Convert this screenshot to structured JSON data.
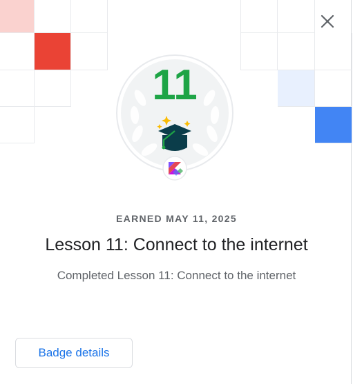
{
  "badge": {
    "number": "11",
    "icon": "graduation-cap-icon",
    "logo": "kotlin-logo-icon"
  },
  "earned_label": "EARNED MAY 11, 2025",
  "title": "Lesson 11: Connect to the internet",
  "subtitle": "Completed Lesson 11: Connect to the internet",
  "details_button": "Badge details",
  "close_icon": "close-icon",
  "colors": {
    "badge_green": "#1ea446",
    "accent_red": "#ea4335",
    "accent_pink": "#fad2cf",
    "accent_blue": "#4285f4",
    "accent_light_blue": "#e8f0fe",
    "link_blue": "#1a73e8"
  }
}
